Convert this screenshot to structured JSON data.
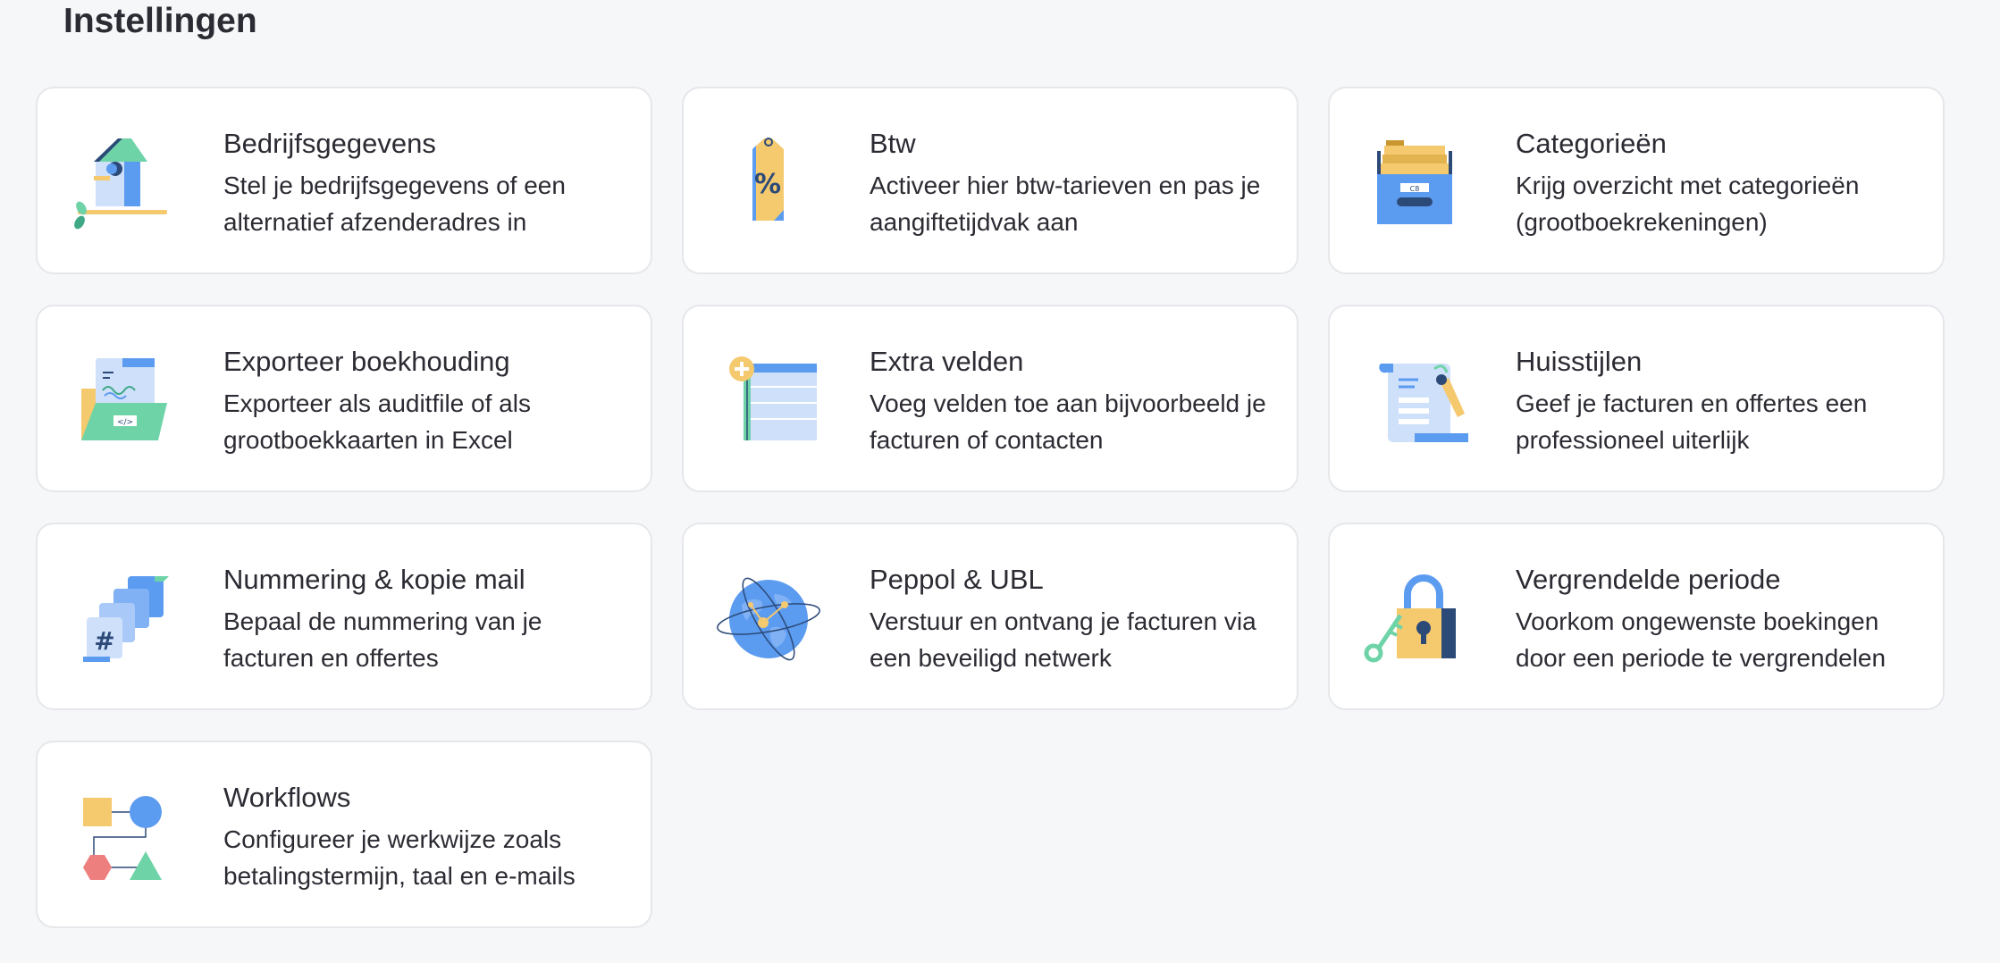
{
  "page": {
    "title": "Instellingen"
  },
  "cards": [
    {
      "title": "Bedrijfsgegevens",
      "description": "Stel je bedrijfsgegevens of een alternatief afzenderadres in",
      "icon": "birdhouse-icon"
    },
    {
      "title": "Btw",
      "description": "Activeer hier btw-tarieven en pas je aangiftetijdvak aan",
      "icon": "percent-tag-icon"
    },
    {
      "title": "Categorieën",
      "description": "Krijg overzicht met categorieën (grootboekrekeningen)",
      "icon": "file-box-icon"
    },
    {
      "title": "Exporteer boekhouding",
      "description": "Exporteer als auditfile of als grootboekkaarten in Excel",
      "icon": "export-folder-icon"
    },
    {
      "title": "Extra velden",
      "description": "Voeg velden toe aan bijvoorbeeld je facturen of contacten",
      "icon": "add-fields-icon"
    },
    {
      "title": "Huisstijlen",
      "description": "Geef je facturen en offertes een professioneel uiterlijk",
      "icon": "scroll-brush-icon"
    },
    {
      "title": "Nummering & kopie mail",
      "description": "Bepaal de nummering van je facturen en offertes",
      "icon": "numbering-pages-icon"
    },
    {
      "title": "Peppol & UBL",
      "description": "Verstuur en ontvang je facturen via een beveiligd netwerk",
      "icon": "globe-network-icon"
    },
    {
      "title": "Vergrendelde periode",
      "description": "Voorkom ongewenste boekingen door een periode te vergrendelen",
      "icon": "padlock-key-icon"
    },
    {
      "title": "Workflows",
      "description": "Configureer je werkwijze zoals betalingstermijn, taal en e-mails",
      "icon": "workflow-shapes-icon"
    }
  ],
  "colors": {
    "blue": "#5b9bf0",
    "light_blue": "#cfe0fb",
    "yellow": "#f5c96e",
    "green": "#6fd3a8",
    "red": "#ee7f7f",
    "navy": "#2c4a78",
    "background": "#f6f7f9",
    "card_border": "#e6e7ea"
  },
  "file_box_label": "C8"
}
